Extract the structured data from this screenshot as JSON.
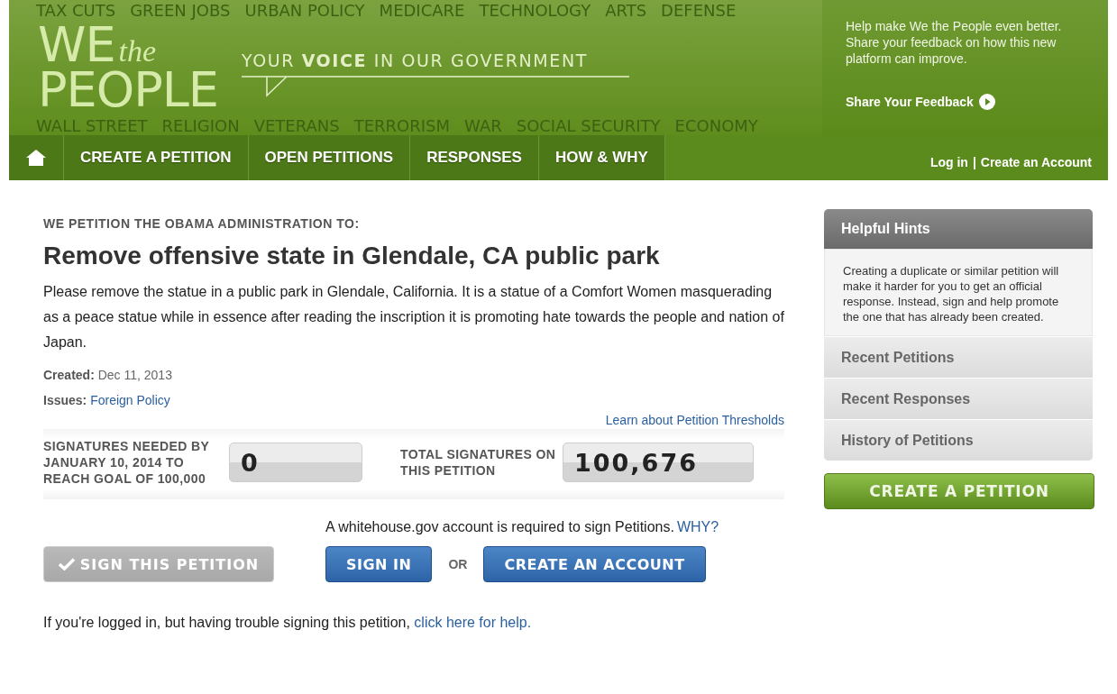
{
  "header": {
    "logo": {
      "line1": "WE",
      "script": "the",
      "line2": "PEOPLE"
    },
    "tagline": {
      "before": "YOUR",
      "bold": "VOICE",
      "after": "IN OUR GOVERNMENT"
    },
    "background_words_top": [
      "TAX CUTS",
      "GREEN JOBS",
      "URBAN POLICY",
      "MEDICARE",
      "TECHNOLOGY",
      "ARTS",
      "DEFENSE"
    ],
    "background_words_bottom": [
      "WALL STREET",
      "RELIGION",
      "VETERANS",
      "TERRORISM",
      "WAR",
      "SOCIAL SECURITY",
      "ECONOMY"
    ],
    "feedback": {
      "text": "Help make We the People even better. Share your feedback on how this new platform can improve.",
      "link": "Share Your Feedback"
    }
  },
  "nav": {
    "tabs": [
      {
        "label": "CREATE A PETITION",
        "selected": false
      },
      {
        "label": "OPEN PETITIONS",
        "selected": false
      },
      {
        "label": "RESPONSES",
        "selected": false
      },
      {
        "label": "HOW & WHY",
        "selected": false
      }
    ],
    "login": "Log in",
    "separator": "|",
    "create_account": "Create an Account"
  },
  "petition": {
    "kicker": "WE PETITION THE OBAMA ADMINISTRATION TO:",
    "title": "Remove offensive state in Glendale, CA public park",
    "body": "Please remove the statue in a public park in Glendale, California. It is a statue of a Comfort Women masquerading as a peace statue while in essence after reading the inscription it is promoting hate towards the people and nation of Japan.",
    "created_label": "Created:",
    "created": "Dec 11, 2013",
    "issues_label": "Issues:",
    "issue": "Foreign Policy",
    "thresholds_link": "Learn about Petition Thresholds",
    "needed_label": "SIGNATURES NEEDED BY JANUARY 10, 2014 TO REACH GOAL OF 100,000",
    "needed": "0",
    "total_label": "TOTAL SIGNATURES ON THIS PETITION",
    "total": "100,676",
    "account_note": "A whitehouse.gov account is required to sign Petitions.",
    "why": "WHY?",
    "sign_button": {
      "label": "SIGN THIS PETITION",
      "disabled": true
    },
    "sign_in": "SIGN IN",
    "or": "OR",
    "create_account": "CREATE AN ACCOUNT",
    "help_text": "If you're logged in, but having trouble signing this petition,",
    "help_link": "click here for help."
  },
  "sidebar": {
    "hints_title": "Helpful Hints",
    "hints_text": "Creating a duplicate or similar petition will make it harder for you to get an official response. Instead, sign and help promote the one that has already been created.",
    "items": [
      {
        "label": "Recent Petitions",
        "selected": false
      },
      {
        "label": "Recent Responses",
        "selected": false
      },
      {
        "label": "History of Petitions",
        "selected": false
      }
    ],
    "create_button": "CREATE A PETITION"
  }
}
